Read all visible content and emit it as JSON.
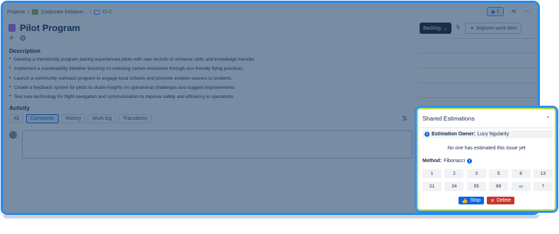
{
  "breadcrumb": {
    "items": [
      "Projects",
      "Corporate Initiative...",
      "CI-2"
    ],
    "separator": "/"
  },
  "header": {
    "watch_count": "1",
    "title": "Pilot Program"
  },
  "controls": {
    "status": "Backlog",
    "improve_label": "Improve work item"
  },
  "description": {
    "heading": "Description",
    "items": [
      "Develop a mentorship program pairing experienced pilots with new recruits to enhance skills and knowledge transfer.",
      "Implement a sustainability initiative focusing on reducing carbon emissions through eco-friendly flying practices.",
      "Launch a community outreach program to engage local schools and promote aviation careers to students.",
      "Create a feedback system for pilots to share insights on operational challenges and suggest improvements.",
      "Test new technology for flight navigation and communication to improve safety and efficiency in operations."
    ]
  },
  "activity": {
    "heading": "Activity",
    "tabs": [
      "All",
      "Comments",
      "History",
      "Work log",
      "Transitions"
    ],
    "active_tab": "Comments"
  },
  "estimation": {
    "title": "Shared Estimations",
    "owner_label": "Estimation Owner:",
    "owner_name": "Lucy Ngularity",
    "empty_message": "No one has estimated this issue yet",
    "method_label": "Method:",
    "method_value": "Fibonacci",
    "cards": [
      "1",
      "2",
      "3",
      "5",
      "8",
      "13",
      "21",
      "34",
      "55",
      "89",
      "∞",
      "?"
    ],
    "stop_label": "Stop",
    "delete_label": "Delete"
  },
  "colors": {
    "frame_border": "#1f8cf5",
    "panel_highlight": "#b8e23c",
    "primary": "#0c66e4",
    "danger": "#c9372c",
    "dim_overlay": "#173860"
  },
  "icons": [
    "chevron-up-icon",
    "info-icon",
    "thumbs-up-icon",
    "close-icon",
    "eye-icon",
    "share-icon",
    "more-icon",
    "plus-icon",
    "settings-icon",
    "lightning-icon",
    "sort-icon"
  ]
}
